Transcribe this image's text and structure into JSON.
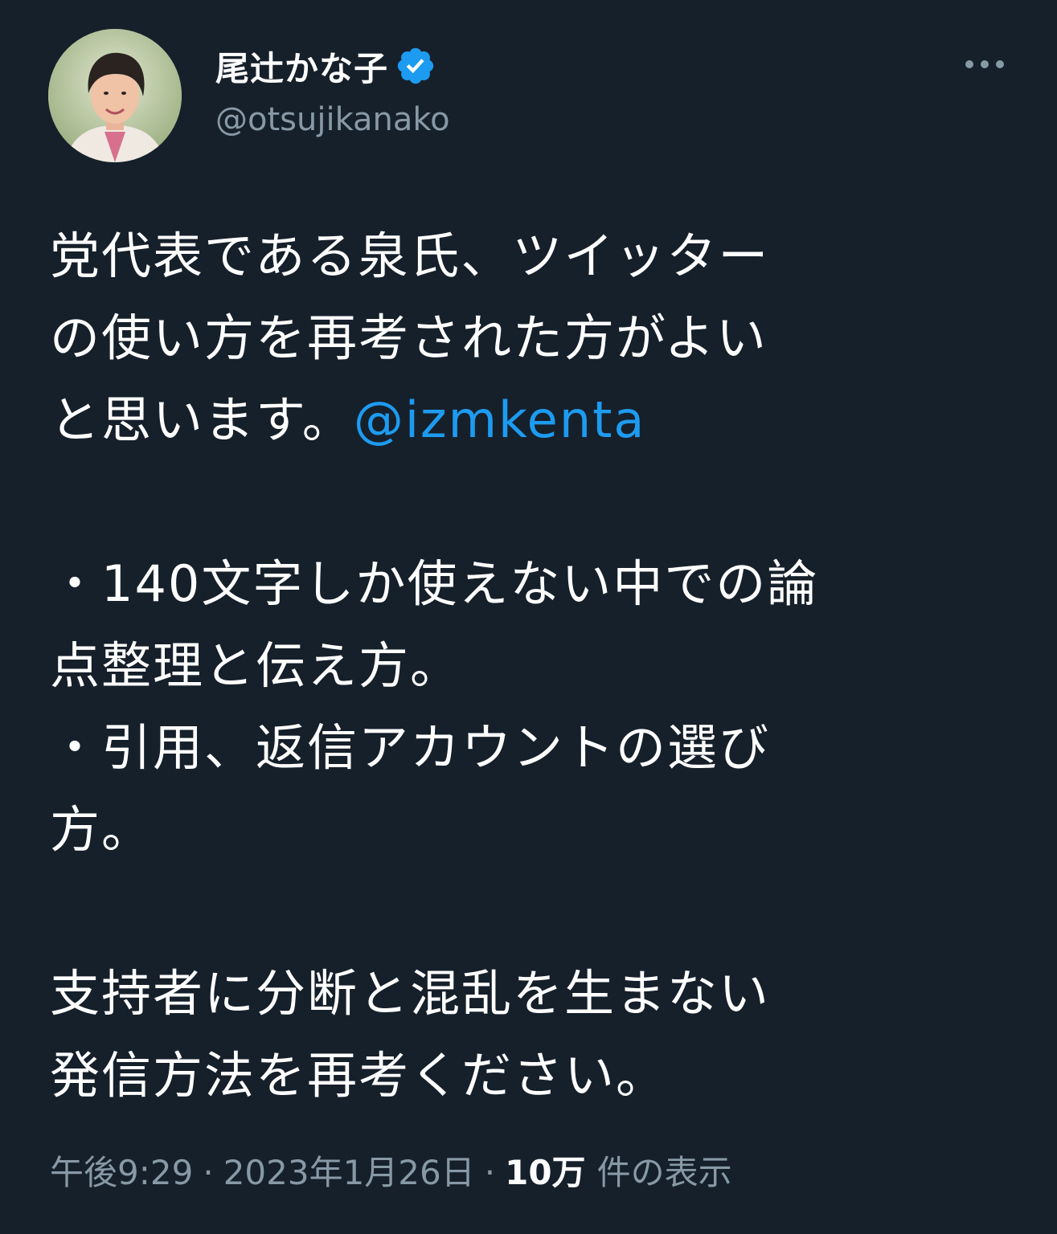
{
  "author": {
    "display_name": "尾辻かな子",
    "handle": "@otsujikanako",
    "verified_icon": "verified-badge-icon",
    "avatar_icon": "profile-photo"
  },
  "more_icon": "more-horizontal-icon",
  "body": {
    "line1": "党代表である泉氏、ツイッター",
    "line2": "の使い方を再考された方がよい",
    "line3_text": "と思います。",
    "mention": "@izmkenta",
    "bullet1_line1": "・140文字しか使えない中での論",
    "bullet1_line2": "点整理と伝え方。",
    "bullet2_line1": "・引用、返信アカウントの選び",
    "bullet2_line2": "方。",
    "closing_line1": "支持者に分断と混乱を生まない",
    "closing_line2": "発信方法を再考ください。"
  },
  "meta": {
    "time": "午後9:29",
    "separator": "·",
    "date": "2023年1月26日",
    "views_count": "10万",
    "views_label": "件の表示"
  },
  "colors": {
    "background": "#16202b",
    "text": "#ffffff",
    "secondary": "#8899a6",
    "accent": "#1d9bf0"
  }
}
